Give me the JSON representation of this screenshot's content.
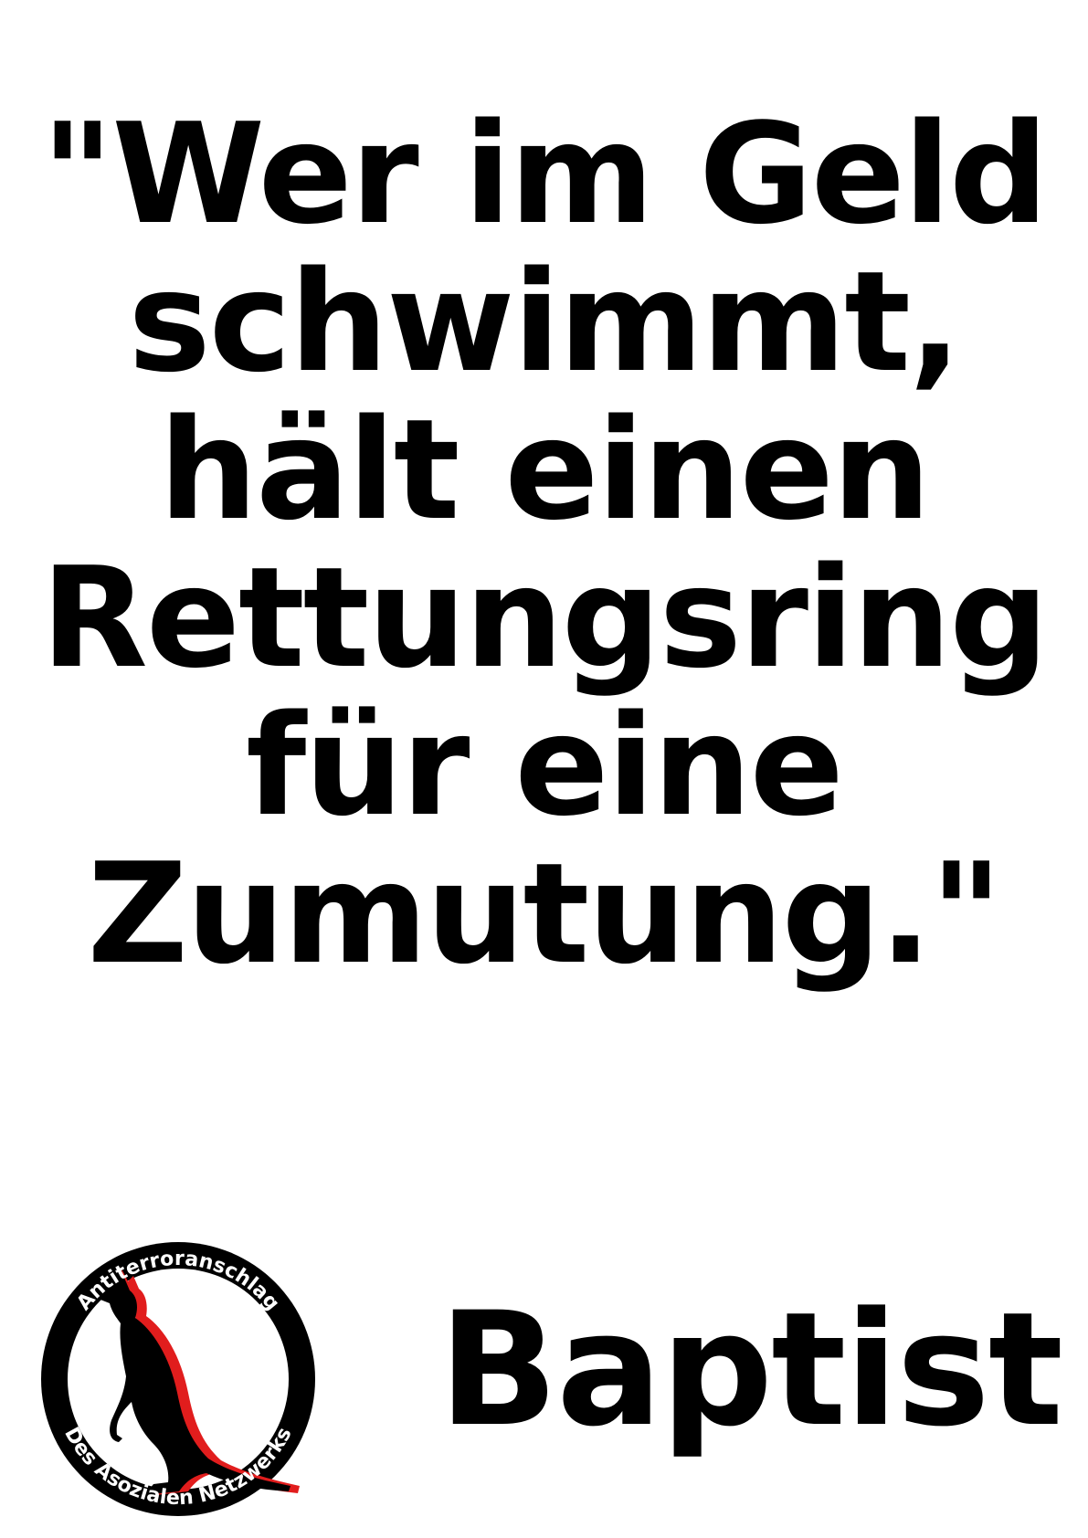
{
  "quote": {
    "lines": [
      "\"Wer im Geld",
      "schwimmt,",
      "hält einen",
      "Rettungsring",
      "für eine",
      "Zumutung.\""
    ]
  },
  "author": {
    "name": "Baptist"
  },
  "logo": {
    "top_text": "Antiterroranschlag",
    "bottom_text": "Des Asozialen Netzwerks",
    "icon": "kangaroo-icon",
    "colors": {
      "ring": "#000000",
      "shadow": "#e11d1d",
      "text": "#ffffff"
    }
  }
}
